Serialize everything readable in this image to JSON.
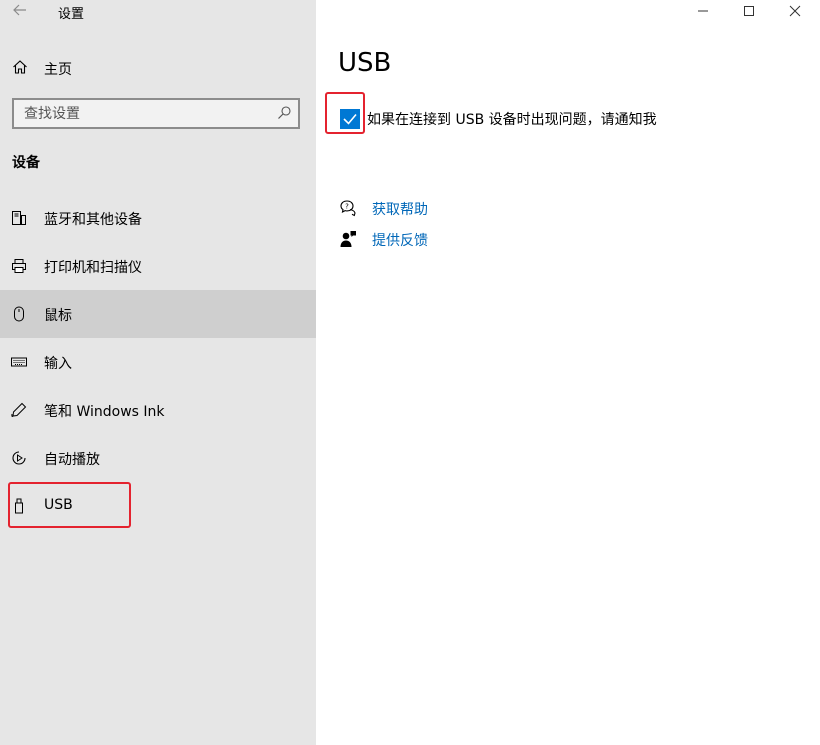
{
  "window": {
    "app_title": "设置"
  },
  "sidebar": {
    "home_label": "主页",
    "search_placeholder": "查找设置",
    "section_title": "设备",
    "items": [
      {
        "label": "蓝牙和其他设备",
        "icon": "bluetooth-devices-icon"
      },
      {
        "label": "打印机和扫描仪",
        "icon": "printer-icon"
      },
      {
        "label": "鼠标",
        "icon": "mouse-icon",
        "selected": true
      },
      {
        "label": "输入",
        "icon": "keyboard-icon"
      },
      {
        "label": "笔和 Windows Ink",
        "icon": "pen-icon"
      },
      {
        "label": "自动播放",
        "icon": "autoplay-icon"
      },
      {
        "label": "USB",
        "icon": "usb-icon"
      }
    ]
  },
  "main": {
    "title": "USB",
    "checkbox": {
      "label": "如果在连接到 USB 设备时出现问题，请通知我",
      "checked": true
    },
    "help_links": [
      {
        "label": "获取帮助",
        "icon": "help-chat-icon"
      },
      {
        "label": "提供反馈",
        "icon": "feedback-icon"
      }
    ]
  },
  "colors": {
    "accent": "#0078d4",
    "link": "#0067b8",
    "highlight": "#e4232f",
    "sidebar_bg": "#e6e6e6",
    "selected_bg": "#cfcfcf"
  }
}
